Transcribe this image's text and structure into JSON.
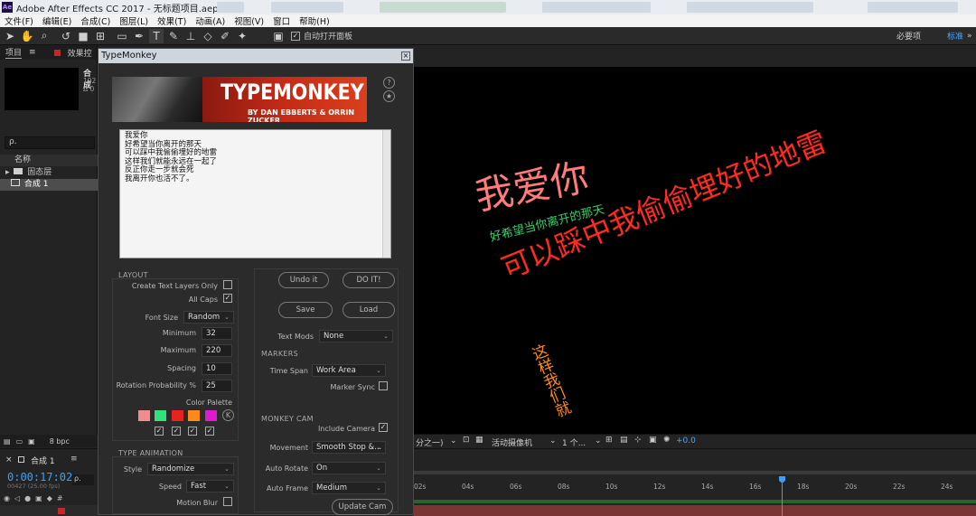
{
  "app": {
    "title": "Adobe After Effects CC 2017 - 无标题项目.aep *",
    "icon": "Ae"
  },
  "menu": [
    "文件(F)",
    "编辑(E)",
    "合成(C)",
    "图层(L)",
    "效果(T)",
    "动画(A)",
    "视图(V)",
    "窗口",
    "帮助(H)"
  ],
  "toolbar": {
    "auto_open_panel": "自动打开面板",
    "workspace_required": "必要项",
    "workspace_standard": "标准",
    "more": "»"
  },
  "project": {
    "tab_label": "项目",
    "tab_menu": "≡",
    "effects_tab": "效果控",
    "comp_name": "合成",
    "comp_detail1": "192",
    "comp_detail2": "Δ 0",
    "search_placeholder": "ρ.",
    "name_header": "名称",
    "items": [
      {
        "label": "固态层",
        "type": "folder"
      },
      {
        "label": "合成 1",
        "type": "comp"
      }
    ],
    "bpc": "8 bpc"
  },
  "typemonkey": {
    "title": "TypeMonkey",
    "logo": "TYPEMONKEY",
    "byline": "BY DAN EBBERTS & ORRIN ZUCKER",
    "help_icon": "?",
    "star_icon": "★",
    "text": "我爱你\n好希望当你离开的那天\n可以踩中我偷偷埋好的地雷\n这样我们就能永远在一起了\n反正你走一步就会死\n我离开你也活不了。",
    "layout": {
      "section": "LAYOUT",
      "create_text_layers_only": {
        "label": "Create Text Layers Only",
        "checked": false
      },
      "all_caps": {
        "label": "All Caps",
        "checked": true
      },
      "font_size": {
        "label": "Font Size",
        "value": "Random"
      },
      "minimum": {
        "label": "Minimum",
        "value": "32"
      },
      "maximum": {
        "label": "Maximum",
        "value": "220"
      },
      "spacing": {
        "label": "Spacing",
        "value": "10"
      },
      "rotation_probability": {
        "label": "Rotation Probability %",
        "value": "25"
      },
      "color_palette": {
        "label": "Color Palette",
        "colors": [
          "#f28b8b",
          "#33e07a",
          "#e8221f",
          "#ff8a1a",
          "#e01ad0"
        ],
        "k_label": "K"
      }
    },
    "type_animation": {
      "section": "TYPE ANIMATION",
      "style": {
        "label": "Style",
        "value": "Randomize"
      },
      "speed": {
        "label": "Speed",
        "value": "Fast"
      },
      "motion_blur": {
        "label": "Motion Blur",
        "checked": false
      }
    },
    "buttons": {
      "undo": "Undo it",
      "do": "DO IT!",
      "save": "Save",
      "load": "Load",
      "update_cam": "Update Cam"
    },
    "text_mods": {
      "label": "Text Mods",
      "value": "None"
    },
    "markers": {
      "section": "MARKERS",
      "time_span": {
        "label": "Time Span",
        "value": "Work Area"
      },
      "marker_sync": {
        "label": "Marker Sync",
        "checked": false
      }
    },
    "monkey_cam": {
      "section": "MONKEY CAM",
      "include_camera": {
        "label": "Include Camera",
        "checked": true
      },
      "movement": {
        "label": "Movement",
        "value": "Smooth Stop &..."
      },
      "auto_rotate": {
        "label": "Auto Rotate",
        "value": "On"
      },
      "auto_frame": {
        "label": "Auto Frame",
        "value": "Medium"
      }
    }
  },
  "viewer": {
    "texts": [
      {
        "text": "我爱你",
        "color": "#ff7a7a"
      },
      {
        "text": "好希望当你离开的那天",
        "color": "#2fd36b"
      },
      {
        "text": "可以踩中我偷偷埋好的地雷",
        "color": "#ff2a20"
      },
      {
        "text": "这样我们就",
        "color": "#ff8a1a"
      }
    ],
    "bar": {
      "resolution": "分之一)",
      "camera": "活动摄像机",
      "views": "1 个...",
      "exposure": "+0.0"
    }
  },
  "timeline": {
    "tab_label": "合成 1",
    "timecode": "0:00:17:02",
    "frames": "00427 (25.00 fps)",
    "ticks": [
      "02s",
      "04s",
      "06s",
      "08s",
      "10s",
      "12s",
      "14s",
      "16s",
      "18s",
      "20s",
      "22s",
      "24s"
    ]
  }
}
